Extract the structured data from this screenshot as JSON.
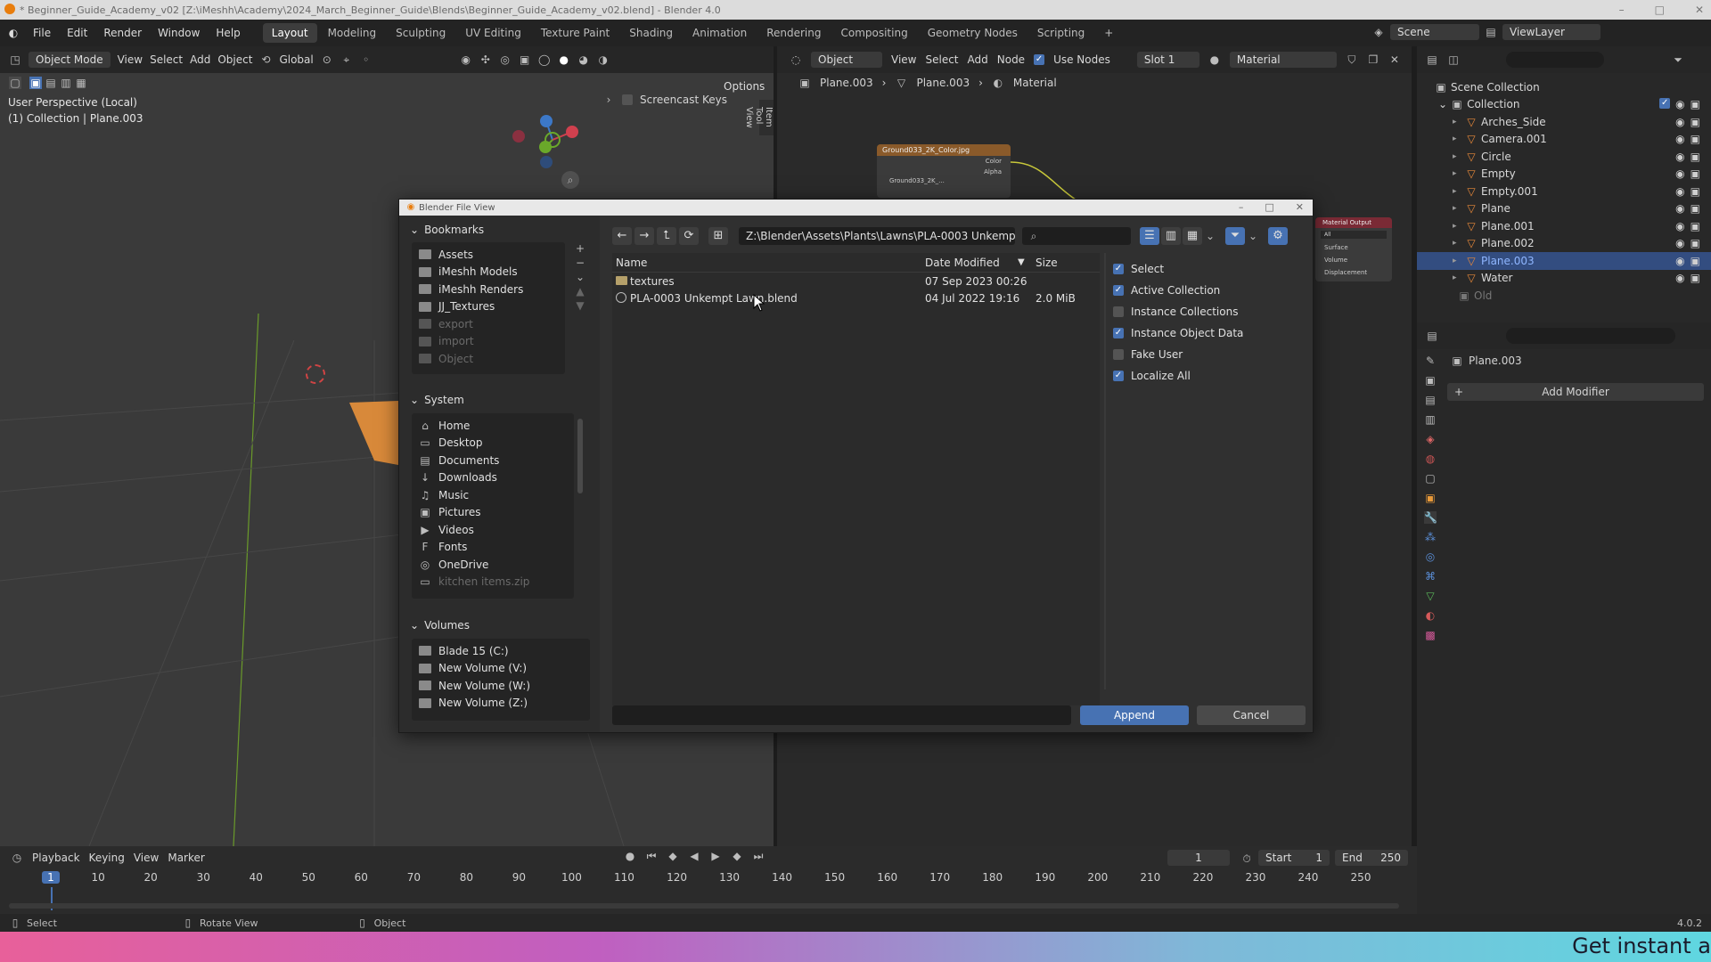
{
  "window": {
    "title": "* Beginner_Guide_Academy_v02 [Z:\\iMeshh\\Academy\\2024_March_Beginner_Guide\\Blends\\Beginner_Guide_Academy_v02.blend] - Blender 4.0"
  },
  "menu": [
    "File",
    "Edit",
    "Render",
    "Window",
    "Help"
  ],
  "workspaces": [
    "Layout",
    "Modeling",
    "Sculpting",
    "UV Editing",
    "Texture Paint",
    "Shading",
    "Animation",
    "Rendering",
    "Compositing",
    "Geometry Nodes",
    "Scripting"
  ],
  "active_workspace": "Layout",
  "scene": "Scene",
  "view_layer": "ViewLayer",
  "viewport": {
    "mode": "Object Mode",
    "menus": [
      "View",
      "Select",
      "Add",
      "Object"
    ],
    "transform": "Global",
    "options": "Options",
    "info_line1": "User Perspective (Local)",
    "info_line2": "(1) Collection | Plane.003",
    "screencast": "Screencast Keys",
    "side_tabs": [
      "Item",
      "Tool",
      "View"
    ]
  },
  "node_editor": {
    "type": "Object",
    "menus": [
      "View",
      "Select",
      "Add",
      "Node"
    ],
    "use_nodes": "Use Nodes",
    "slot": "Slot 1",
    "material": "Material",
    "breadcrumb": [
      "Plane.003",
      "Plane.003",
      "Material"
    ],
    "image_node": {
      "title": "Ground033_2K_Color.jpg",
      "out1": "Color",
      "out2": "Alpha",
      "file": "Ground033_2K_..."
    },
    "output_node": {
      "title": "Material Output",
      "target": "All",
      "in1": "Surface",
      "in2": "Volume",
      "in3": "Displacement"
    }
  },
  "outliner": {
    "root": "Scene Collection",
    "collection": "Collection",
    "items": [
      {
        "name": "Arches_Side",
        "selected": false
      },
      {
        "name": "Camera.001",
        "selected": false
      },
      {
        "name": "Circle",
        "selected": false
      },
      {
        "name": "Empty",
        "selected": false
      },
      {
        "name": "Empty.001",
        "selected": false
      },
      {
        "name": "Plane",
        "selected": false
      },
      {
        "name": "Plane.001",
        "selected": false
      },
      {
        "name": "Plane.002",
        "selected": false
      },
      {
        "name": "Plane.003",
        "selected": true
      },
      {
        "name": "Water",
        "selected": false
      }
    ],
    "old": "Old"
  },
  "properties": {
    "object": "Plane.003",
    "add_modifier": "Add Modifier"
  },
  "dialog": {
    "title": "Blender File View",
    "bookmarks_label": "Bookmarks",
    "bookmarks": [
      {
        "label": "Assets",
        "dim": false
      },
      {
        "label": "iMeshh Models",
        "dim": false
      },
      {
        "label": "iMeshh Renders",
        "dim": false
      },
      {
        "label": "JJ_Textures",
        "dim": false
      },
      {
        "label": "export",
        "dim": true
      },
      {
        "label": "import",
        "dim": true
      },
      {
        "label": "Object",
        "dim": true
      }
    ],
    "system_label": "System",
    "system": [
      {
        "label": "Home",
        "icon": "⌂",
        "dim": false
      },
      {
        "label": "Desktop",
        "icon": "▭",
        "dim": false
      },
      {
        "label": "Documents",
        "icon": "▤",
        "dim": false
      },
      {
        "label": "Downloads",
        "icon": "↓",
        "dim": false
      },
      {
        "label": "Music",
        "icon": "♫",
        "dim": false
      },
      {
        "label": "Pictures",
        "icon": "▣",
        "dim": false
      },
      {
        "label": "Videos",
        "icon": "▶",
        "dim": false
      },
      {
        "label": "Fonts",
        "icon": "F",
        "dim": false
      },
      {
        "label": "OneDrive",
        "icon": "◎",
        "dim": false
      },
      {
        "label": "kitchen items.zip",
        "icon": "▭",
        "dim": true
      }
    ],
    "volumes_label": "Volumes",
    "volumes": [
      "Blade 15 (C:)",
      "New Volume (V:)",
      "New Volume (W:)",
      "New Volume (Z:)"
    ],
    "path": "Z:\\Blender\\Assets\\Plants\\Lawns\\PLA-0003 Unkempt La...",
    "columns": {
      "name": "Name",
      "date": "Date Modified",
      "size": "Size"
    },
    "files": [
      {
        "name": "textures",
        "date": "07 Sep 2023 00:26",
        "size": "",
        "kind": "folder"
      },
      {
        "name": "PLA-0003 Unkempt Lawn.blend",
        "date": "04 Jul 2022 19:16",
        "size": "2.0 MiB",
        "kind": "blend"
      }
    ],
    "options": [
      {
        "label": "Select",
        "checked": true
      },
      {
        "label": "Active Collection",
        "checked": true
      },
      {
        "label": "Instance Collections",
        "checked": false
      },
      {
        "label": "Instance Object Data",
        "checked": true
      },
      {
        "label": "Fake User",
        "checked": false
      },
      {
        "label": "Localize All",
        "checked": true
      }
    ],
    "filename": "",
    "append": "Append",
    "cancel": "Cancel"
  },
  "timeline": {
    "menus": [
      "Playback",
      "Keying",
      "View",
      "Marker"
    ],
    "current_frame": "1",
    "start_label": "Start",
    "start": "1",
    "end_label": "End",
    "end": "250",
    "ticks": [
      "1",
      "10",
      "20",
      "30",
      "40",
      "50",
      "60",
      "70",
      "80",
      "90",
      "100",
      "110",
      "120",
      "130",
      "140",
      "150",
      "160",
      "170",
      "180",
      "190",
      "200",
      "210",
      "220",
      "230",
      "240",
      "250"
    ]
  },
  "status": {
    "select": "Select",
    "rotate": "Rotate View",
    "object": "Object",
    "version": "4.0.2"
  },
  "banner": {
    "text": "Get instant a"
  },
  "colors": {
    "accent": "#4772b3",
    "selection": "#334d80",
    "axis_x": "#d0404e",
    "axis_y": "#6aa82a",
    "axis_z": "#3c78c8"
  }
}
